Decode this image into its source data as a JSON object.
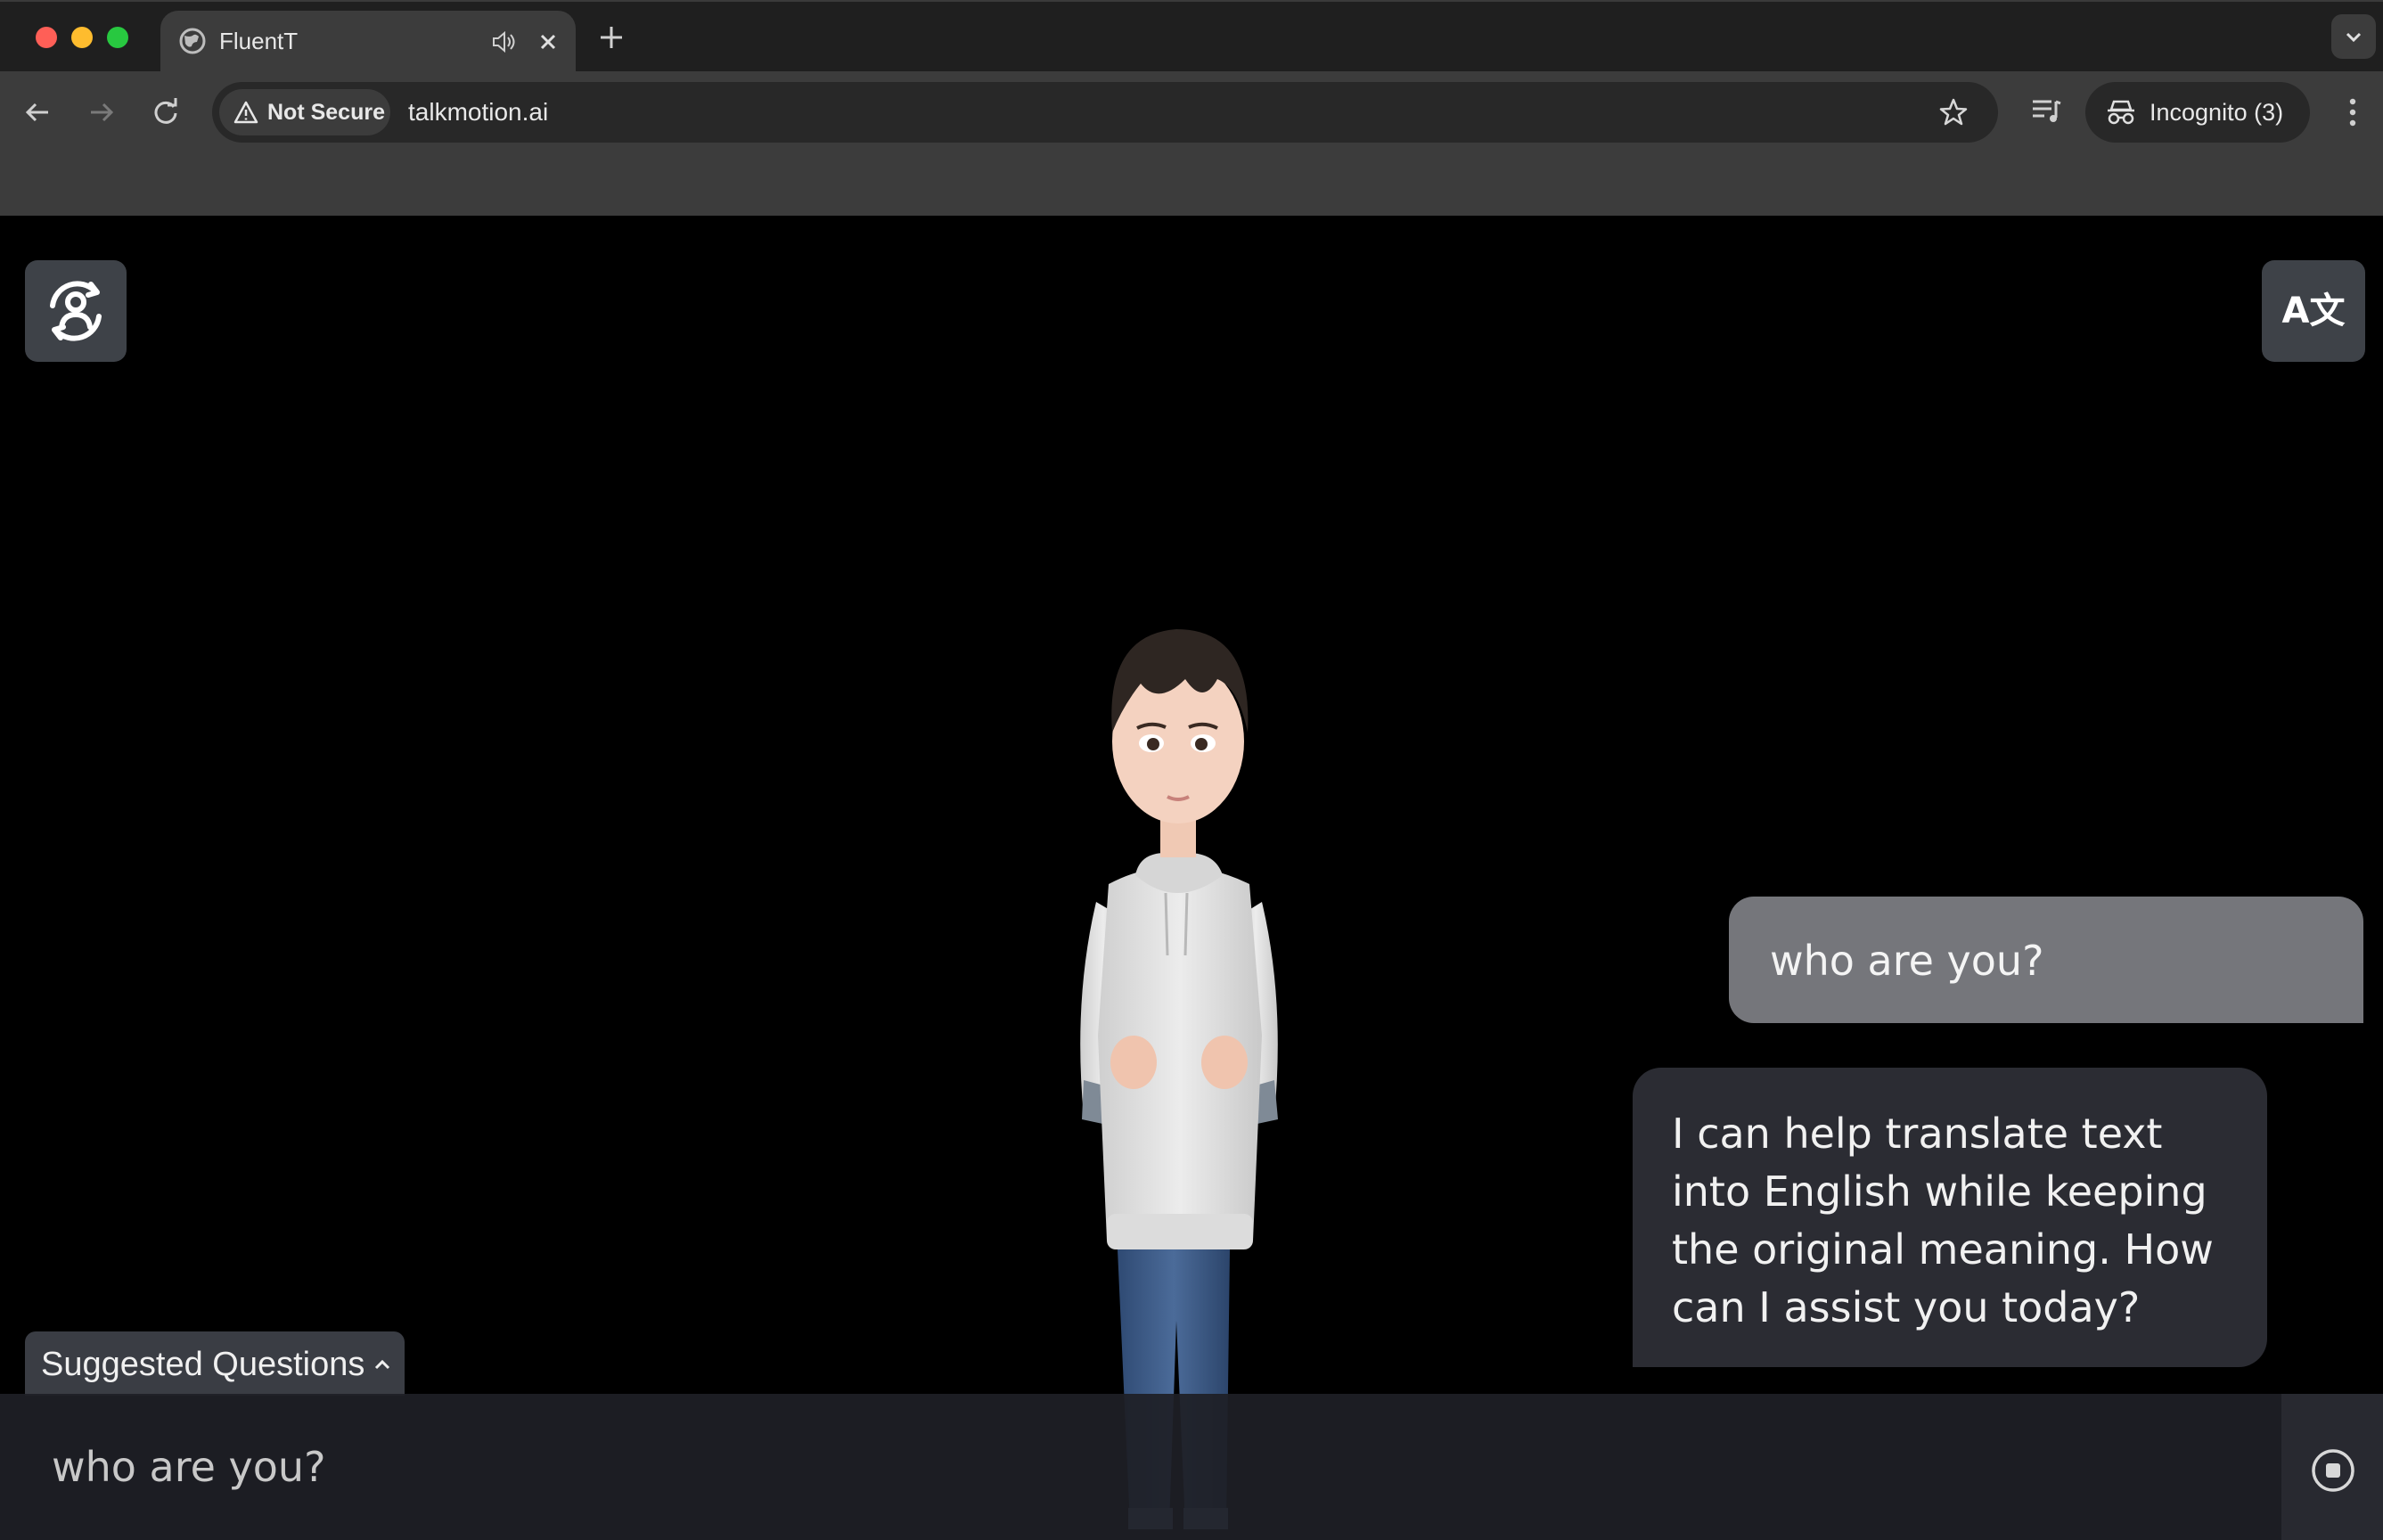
{
  "browser": {
    "tab": {
      "title": "FluentT"
    },
    "address": {
      "security_label": "Not Secure",
      "url": "talkmotion.ai"
    },
    "profile": {
      "label": "Incognito (3)"
    },
    "icons": [
      "globe-icon",
      "speaker-icon",
      "close-icon",
      "plus-icon",
      "chevron-down-icon",
      "back-arrow-icon",
      "forward-arrow-icon",
      "reload-icon",
      "warning-icon",
      "star-icon",
      "media-queue-icon",
      "incognito-icon",
      "more-vert-icon"
    ]
  },
  "app": {
    "colors": {
      "background": "#000000",
      "icon_button": "#3e4248",
      "user_bubble": "#75767b",
      "bot_bubble": "#2b2c33",
      "input_bar": "#1e1f26"
    },
    "top_left_button": {
      "icon": "avatar-switch-icon"
    },
    "top_right_button": {
      "label": "A文",
      "icon": "translate-icon"
    },
    "chat": {
      "messages": [
        {
          "role": "user",
          "text": "who are you?"
        },
        {
          "role": "assistant",
          "lines": [
            "I can help translate text",
            "into English while keeping",
            "the original meaning. How",
            "can I assist you today?"
          ]
        }
      ]
    },
    "suggested_questions": {
      "label": "Suggested Questions",
      "icon": "chevron-up-icon"
    },
    "input": {
      "text": "who are you?"
    },
    "stop_button": {
      "icon": "stop-circle-icon"
    }
  }
}
